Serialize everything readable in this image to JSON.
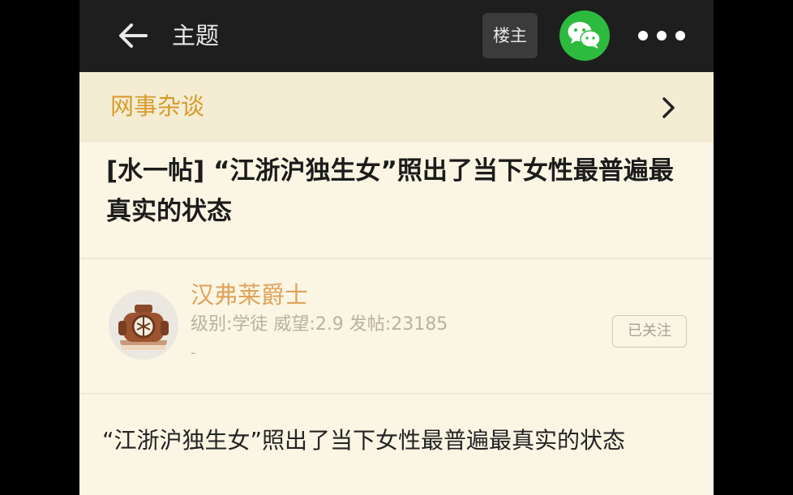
{
  "topbar": {
    "back_icon": "arrow-left-icon",
    "title": "主题",
    "op_label": "楼主",
    "wechat_icon": "wechat-icon",
    "more_icon": "more-horizontal-icon"
  },
  "category": {
    "name": "网事杂谈",
    "chevron_icon": "chevron-right-icon"
  },
  "post": {
    "title": "[水一帖] “江浙沪独生女”照出了当下女性最普遍最真实的状态",
    "body": "“江浙沪独生女”照出了当下女性最普遍最真实的状态"
  },
  "author": {
    "name": "汉弗莱爵士",
    "meta": "级别:学徒 威望:2.9 发帖:23185",
    "extra": "-",
    "follow_label": "已关注",
    "avatar_icon": "diving-helmet-avatar"
  },
  "colors": {
    "topbar_bg": "#1e1e1e",
    "page_bg": "#fbf6e4",
    "category_text": "#d99a2b",
    "author_name": "#e0a35a",
    "wechat_green": "#2dbb3f"
  }
}
